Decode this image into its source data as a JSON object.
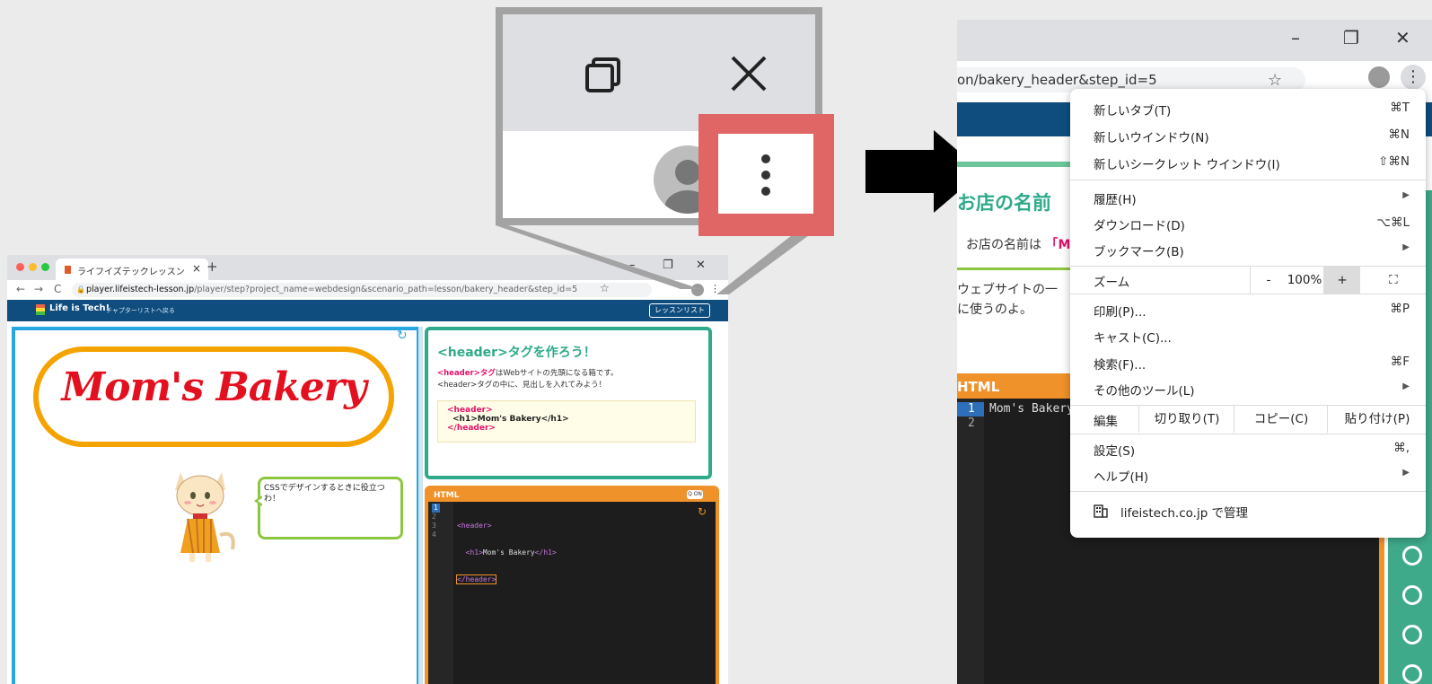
{
  "left_browser": {
    "tab_title": "ライフイズテックレッスン",
    "tab_close": "×",
    "new_tab": "+",
    "window_controls": [
      "–",
      "❐",
      "✕"
    ],
    "nav": [
      "←",
      "→",
      "C"
    ],
    "url_host": "player.lifeistech-lesson.jp",
    "url_path": "/player/step?project_name=webdesign&scenario_path=lesson/bakery_header&step_id=5",
    "star": "☆",
    "kebab": "⋮",
    "app_logo": "Life is Tech!",
    "back_to_chapters": "チャプターリストへ戻る",
    "lesson_list": "レッスンリスト"
  },
  "preview": {
    "site_title": "Mom's Bakery",
    "bubble": "CSSでデザインするときに役立つわ！"
  },
  "instruction": {
    "title": "<header>タグを作ろう！",
    "line1_tag": "<header>タグ",
    "line1_rest": "はWebサイトの先頭になる箱です。",
    "line2": "<header>タグの中に、見出しを入れてみよう！",
    "code_open": "<header>",
    "code_mid": "<h1>Mom's Bakery</h1>",
    "code_close": "</header>"
  },
  "editor": {
    "label": "HTML",
    "toggle": "Q ON",
    "lines": [
      "1",
      "2",
      "3",
      "4"
    ],
    "code_line1": "<header>",
    "code_line2_open": "<h1>",
    "code_line2_text": "Mom's Bakery",
    "code_line2_close": "</h1>",
    "code_line3": "</header>"
  },
  "zoom_callout": {
    "kebab": "⋮"
  },
  "right_browser": {
    "window_controls": [
      "–",
      "❐",
      "✕"
    ],
    "url_fragment": "on/bakery_header&step_id=5",
    "star": "☆",
    "kebab": "⋮",
    "heading_fragment": "お店の名前",
    "line1_text": "お店の名前は",
    "line1_highlight": "「M",
    "line2a": "ウェブサイトの一",
    "line2b": "に使うのよ。",
    "editor_label": "HTML",
    "editor_lines": [
      "1",
      "2"
    ],
    "editor_code": "Mom's Bakery"
  },
  "chrome_menu": {
    "new_tab": "新しいタブ(T)",
    "new_tab_key": "⌘T",
    "new_window": "新しいウインドウ(N)",
    "new_window_key": "⌘N",
    "incognito": "新しいシークレット ウインドウ(I)",
    "incognito_key": "⇧⌘N",
    "history": "履歴(H)",
    "downloads": "ダウンロード(D)",
    "downloads_key": "⌥⌘L",
    "bookmarks": "ブックマーク(B)",
    "zoom": "ズーム",
    "zoom_minus": "-",
    "zoom_value": "100%",
    "zoom_plus": "+",
    "fullscreen": "⛶",
    "print": "印刷(P)...",
    "print_key": "⌘P",
    "cast": "キャスト(C)...",
    "find": "検索(F)...",
    "find_key": "⌘F",
    "more_tools": "その他のツール(L)",
    "edit": "編集",
    "cut": "切り取り(T)",
    "copy": "コピー(C)",
    "paste": "貼り付け(P)",
    "settings": "設定(S)",
    "settings_key": "⌘,",
    "help": "ヘルプ(H)",
    "managed": "lifeistech.co.jp で管理"
  },
  "colors": {
    "appbar": "#0f4d7e",
    "preview_border": "#27a6e0",
    "instruction_green": "#2eaa8a",
    "editor_orange": "#f0922a",
    "highlight_red": "#e06565",
    "bakery_red": "#e3101f",
    "pill_orange": "#f5a300"
  }
}
